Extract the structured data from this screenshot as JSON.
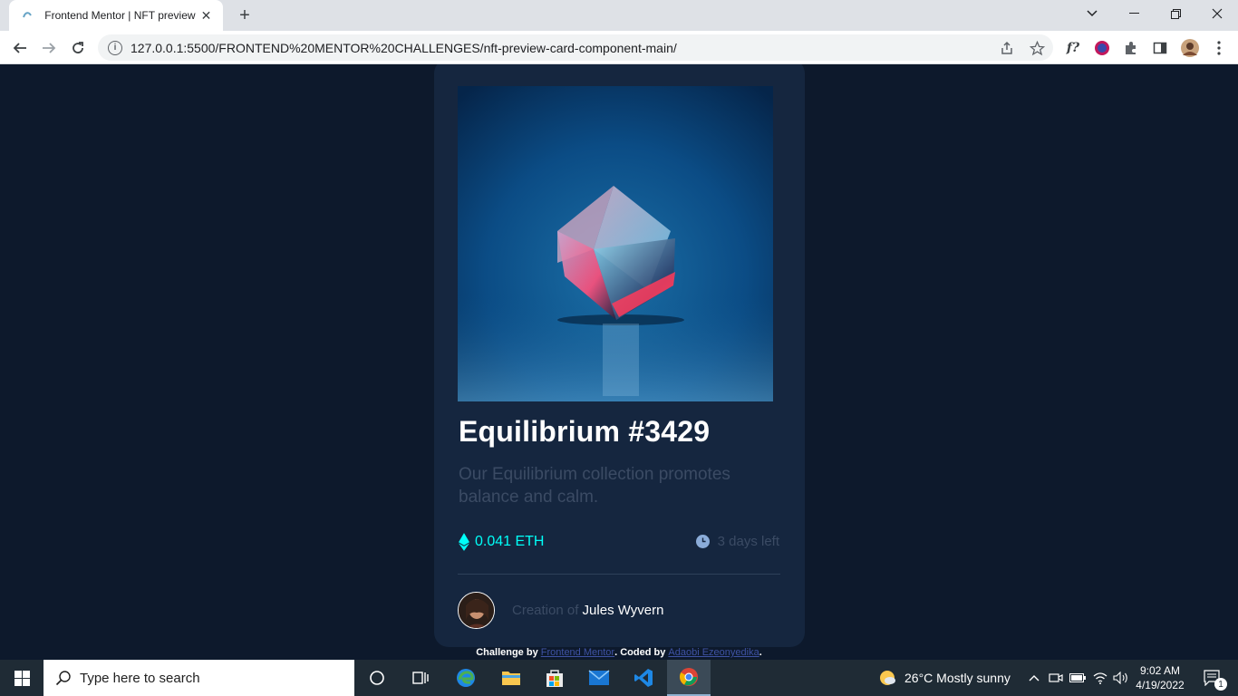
{
  "browser": {
    "tab_title": "Frontend Mentor | NFT preview c",
    "url": "127.0.0.1:5500/FRONTEND%20MENTOR%20CHALLENGES/nft-preview-card-component-main/",
    "ext_label": "f?"
  },
  "card": {
    "title": "Equilibrium #3429",
    "description": "Our Equilibrium collection promotes balance and calm.",
    "price": "0.041 ETH",
    "time_left": "3 days left",
    "creator_prefix": "Creation of",
    "creator_name": "Jules Wyvern"
  },
  "attribution": {
    "prefix": "Challenge by",
    "challenge_link": "Frontend Mentor",
    "coded_by": ". Coded by",
    "author_link": "Adaobi Ezeonyedika",
    "suffix": "."
  },
  "taskbar": {
    "search_placeholder": "Type here to search",
    "weather": "26°C  Mostly sunny",
    "time": "9:02 AM",
    "date": "4/19/2022",
    "notifications": "1"
  },
  "colors": {
    "page_bg": "#0d192c",
    "card_bg": "#15263f",
    "accent_cyan": "#00fff8",
    "muted_text": "#3b4b64"
  }
}
